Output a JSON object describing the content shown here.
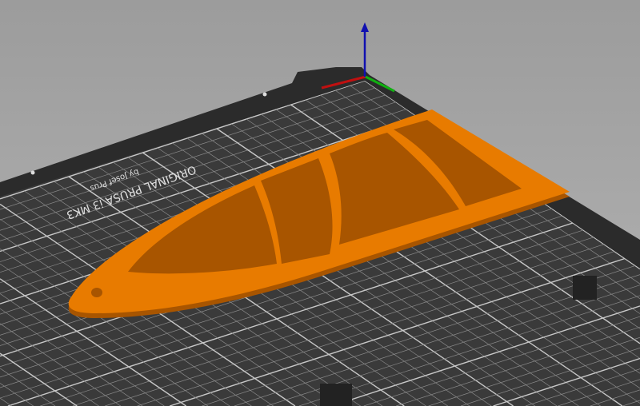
{
  "viewport": {
    "background_top": "#9c9c9c",
    "background_bottom": "#b4b4b4"
  },
  "bed": {
    "model_label": "ORIGINAL PRUSA i3 MK3",
    "maker_label": "by Josef Prus",
    "frame_color": "#2b2b2b",
    "surface_color": "#3a3a3a",
    "grid_color": "#8a8a8a",
    "grid_major_color": "#c8c8c8"
  },
  "axes": {
    "x_color": "#c01010",
    "y_color": "#10b010",
    "z_color": "#1010b0"
  },
  "part": {
    "color": "#e87b00",
    "edge_color": "#a85500"
  }
}
